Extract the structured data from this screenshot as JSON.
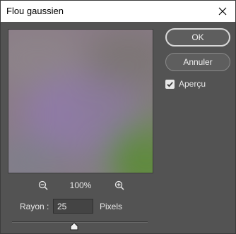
{
  "dialog": {
    "title": "Flou gaussien",
    "close_icon": "close-icon"
  },
  "preview": {
    "zoom_level": "100%",
    "zoom_out_icon": "zoom-out-icon",
    "zoom_in_icon": "zoom-in-icon"
  },
  "radius": {
    "label": "Rayon :",
    "value": "25",
    "unit": "Pixels",
    "slider_fraction": 0.46
  },
  "buttons": {
    "ok": "OK",
    "cancel": "Annuler"
  },
  "preview_toggle": {
    "label": "Aperçu",
    "checked": true
  },
  "colors": {
    "dialog_bg": "#535353",
    "titlebar_bg": "#ffffff",
    "accent_primary_border": "#d9d9d9"
  }
}
